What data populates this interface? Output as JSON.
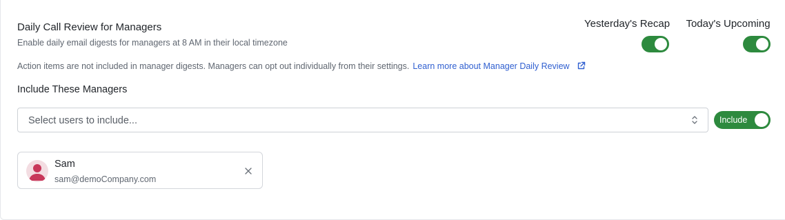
{
  "header": {
    "title": "Daily Call Review for Managers",
    "subtitle": "Enable daily email digests for managers at 8 AM in their local timezone"
  },
  "toggles": {
    "yesterday": {
      "label": "Yesterday's Recap",
      "enabled": true
    },
    "today": {
      "label": "Today's Upcoming",
      "enabled": true
    }
  },
  "info": {
    "text": "Action items are not included in manager digests. Managers can opt out individually from their settings.",
    "link_label": "Learn more about Manager Daily Review",
    "link_icon": "external-link-icon"
  },
  "include_section": {
    "label": "Include These Managers",
    "select_placeholder": "Select users to include...",
    "select_icon": "chevron-up-down-icon",
    "mode_label": "Include",
    "mode_enabled": true
  },
  "selected_users": [
    {
      "name": "Sam",
      "email": "sam@demoCompany.com",
      "avatar_icon": "user-avatar-icon",
      "remove_icon": "close-icon"
    }
  ],
  "colors": {
    "accent_green": "#2d8a3e",
    "link_blue": "#2f5fd0",
    "avatar_red": "#c8375a"
  }
}
